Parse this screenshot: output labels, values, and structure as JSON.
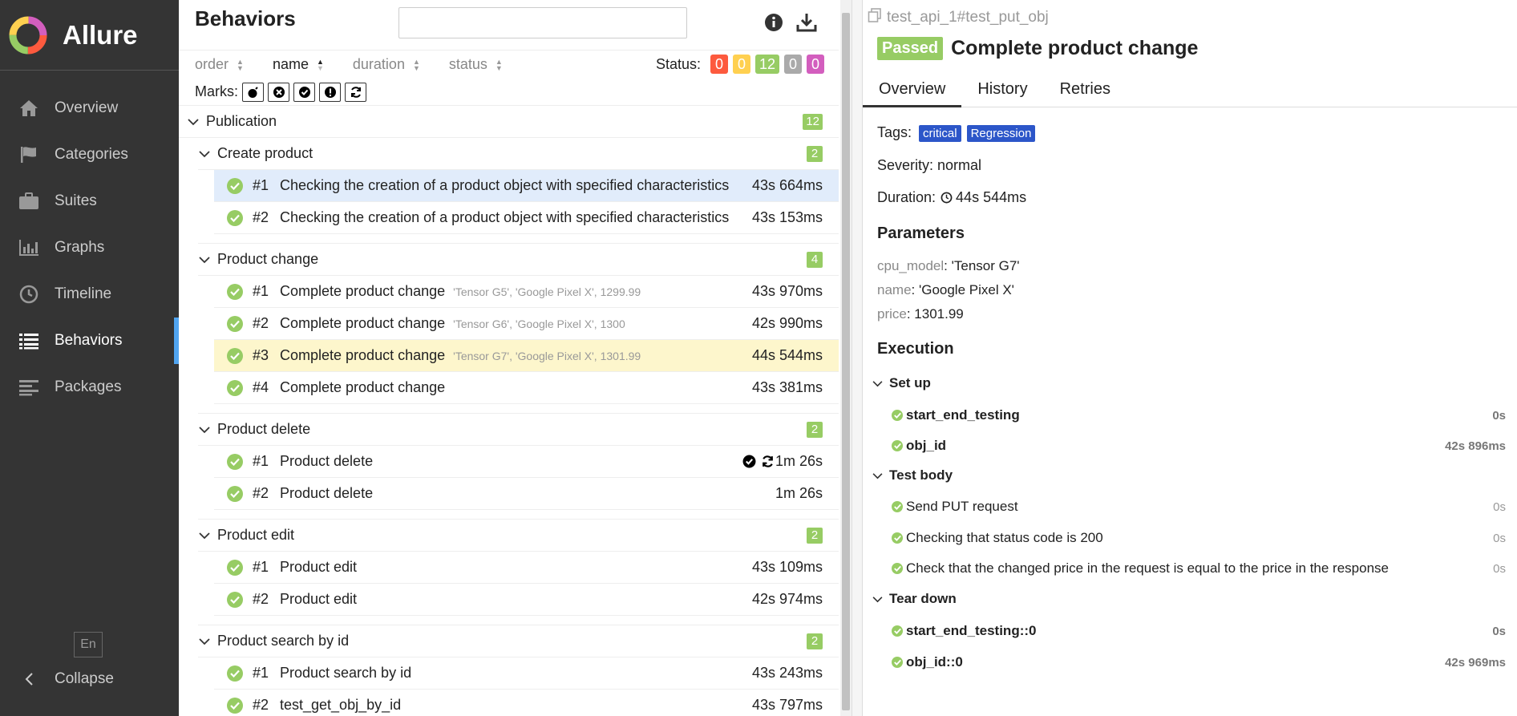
{
  "app": {
    "name": "Allure"
  },
  "sidebar": {
    "items": [
      {
        "label": "Overview",
        "icon": "home-icon"
      },
      {
        "label": "Categories",
        "icon": "flag-icon"
      },
      {
        "label": "Suites",
        "icon": "briefcase-icon"
      },
      {
        "label": "Graphs",
        "icon": "bar-chart-icon"
      },
      {
        "label": "Timeline",
        "icon": "clock-icon"
      },
      {
        "label": "Behaviors",
        "icon": "list-icon",
        "active": true
      },
      {
        "label": "Packages",
        "icon": "align-left-icon"
      }
    ],
    "language": "En",
    "collapse_label": "Collapse"
  },
  "tree": {
    "title": "Behaviors",
    "search_placeholder": "",
    "sort": {
      "order": "order",
      "name": "name",
      "duration": "duration",
      "status": "status"
    },
    "status_label": "Status:",
    "status_counts": [
      {
        "value": "0",
        "color": "#fd5a3e"
      },
      {
        "value": "0",
        "color": "#ffd050"
      },
      {
        "value": "12",
        "color": "#97cc64"
      },
      {
        "value": "0",
        "color": "#aaaaaa"
      },
      {
        "value": "0",
        "color": "#d35ebe"
      }
    ],
    "marks_label": "Marks:",
    "publication": {
      "name": "Publication",
      "count": "12"
    },
    "groups": [
      {
        "name": "Create product",
        "count": "2",
        "tests": [
          {
            "num": "#1",
            "name": "Checking the creation of a product object with specified characteristics",
            "params": "",
            "duration": "43s 664ms"
          },
          {
            "num": "#2",
            "name": "Checking the creation of a product object with specified characteristics",
            "params": "",
            "duration": "43s 153ms"
          }
        ]
      },
      {
        "name": "Product change",
        "count": "4",
        "tests": [
          {
            "num": "#1",
            "name": "Complete product change",
            "params": "'Tensor G5', 'Google Pixel X', 1299.99",
            "duration": "43s 970ms"
          },
          {
            "num": "#2",
            "name": "Complete product change",
            "params": "'Tensor G6', 'Google Pixel X', 1300",
            "duration": "42s 990ms"
          },
          {
            "num": "#3",
            "name": "Complete product change",
            "params": "'Tensor G7', 'Google Pixel X', 1301.99",
            "duration": "44s 544ms"
          },
          {
            "num": "#4",
            "name": "Complete product change",
            "params": "",
            "duration": "43s 381ms"
          }
        ]
      },
      {
        "name": "Product delete",
        "count": "2",
        "tests": [
          {
            "num": "#1",
            "name": "Product delete",
            "params": "",
            "duration": "1m 26s"
          },
          {
            "num": "#2",
            "name": "Product delete",
            "params": "",
            "duration": "1m 26s"
          }
        ]
      },
      {
        "name": "Product edit",
        "count": "2",
        "tests": [
          {
            "num": "#1",
            "name": "Product edit",
            "params": "",
            "duration": "43s 109ms"
          },
          {
            "num": "#2",
            "name": "Product edit",
            "params": "",
            "duration": "42s 974ms"
          }
        ]
      },
      {
        "name": "Product search by id",
        "count": "2",
        "tests": [
          {
            "num": "#1",
            "name": "Product search by id",
            "params": "",
            "duration": "43s 243ms"
          },
          {
            "num": "#2",
            "name": "test_get_obj_by_id",
            "params": "",
            "duration": "43s 797ms"
          }
        ]
      }
    ]
  },
  "detail": {
    "breadcrumb": "test_api_1#test_put_obj",
    "status": "Passed",
    "title": "Complete product change",
    "tabs": [
      "Overview",
      "History",
      "Retries"
    ],
    "tags_label": "Tags:",
    "tags": [
      "critical",
      "Regression"
    ],
    "severity": "Severity: normal",
    "duration_label": "Duration:",
    "duration": "44s 544ms",
    "parameters_title": "Parameters",
    "params": [
      {
        "key": "cpu_model",
        "value": ": 'Tensor G7'"
      },
      {
        "key": "name",
        "value": ": 'Google Pixel X'"
      },
      {
        "key": "price",
        "value": ": 1301.99"
      }
    ],
    "execution_title": "Execution",
    "setup": {
      "label": "Set up",
      "steps": [
        {
          "name": "start_end_testing",
          "duration": "0s"
        },
        {
          "name": "obj_id",
          "duration": "42s 896ms"
        }
      ]
    },
    "body": {
      "label": "Test body",
      "steps": [
        {
          "name": "Send PUT request",
          "duration": "0s"
        },
        {
          "name": "Checking that status code is 200",
          "duration": "0s"
        },
        {
          "name": "Check that the changed price in the request is equal to the price in the response",
          "duration": "0s"
        }
      ]
    },
    "teardown": {
      "label": "Tear down",
      "steps": [
        {
          "name": "start_end_testing::0",
          "duration": "0s"
        },
        {
          "name": "obj_id::0",
          "duration": "42s 969ms"
        }
      ]
    }
  }
}
